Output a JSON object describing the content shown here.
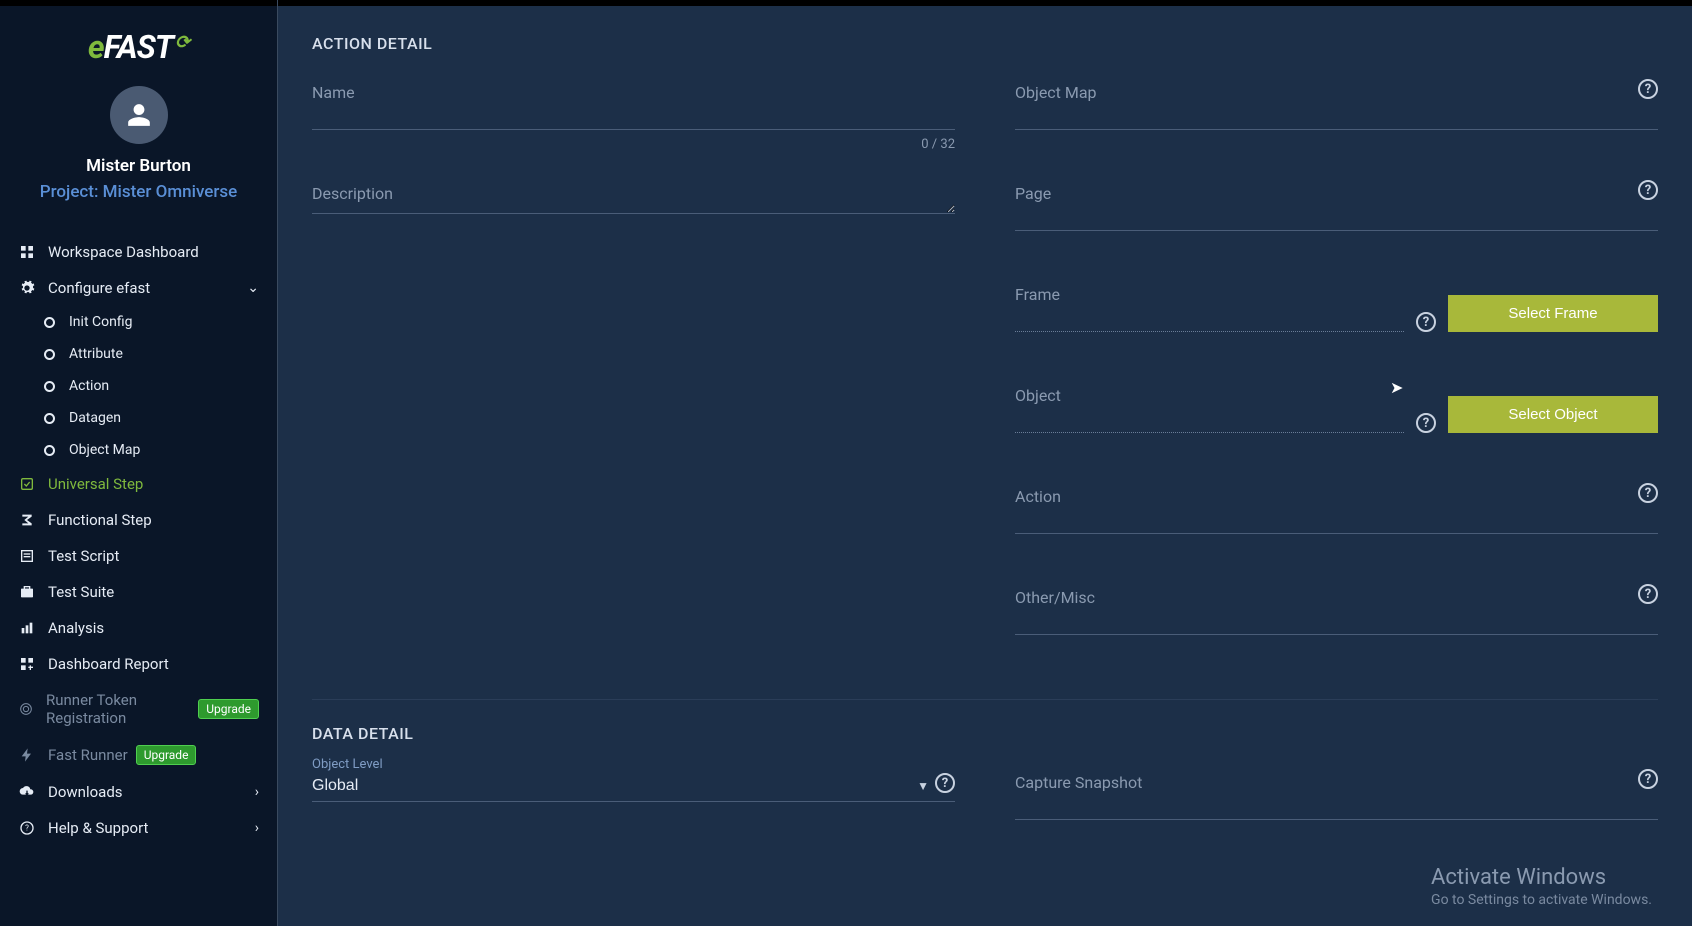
{
  "brand": {
    "name_e": "e",
    "name_fast": "FAST"
  },
  "user": {
    "name": "Mister Burton",
    "project": "Project: Mister Omniverse"
  },
  "nav": {
    "workspace": "Workspace Dashboard",
    "configure": "Configure efast",
    "init_config": "Init Config",
    "attribute": "Attribute",
    "action": "Action",
    "datagen": "Datagen",
    "object_map": "Object Map",
    "universal_step": "Universal Step",
    "functional_step": "Functional Step",
    "test_script": "Test Script",
    "test_suite": "Test Suite",
    "analysis": "Analysis",
    "dashboard_report": "Dashboard Report",
    "runner_token": "Runner Token Registration",
    "fast_runner": "Fast Runner",
    "downloads": "Downloads",
    "help": "Help & Support",
    "upgrade": "Upgrade"
  },
  "section": {
    "action_detail": "ACTION DETAIL",
    "data_detail": "DATA DETAIL"
  },
  "fields": {
    "name": "Name",
    "name_counter": "0 / 32",
    "description": "Description",
    "object_map": "Object Map",
    "page": "Page",
    "frame": "Frame",
    "object": "Object",
    "action": "Action",
    "other_misc": "Other/Misc",
    "object_level_label": "Object Level",
    "object_level_value": "Global",
    "capture_snapshot": "Capture Snapshot"
  },
  "buttons": {
    "select_frame": "Select Frame",
    "select_object": "Select Object"
  },
  "watermark": {
    "line1": "Activate Windows",
    "line2": "Go to Settings to activate Windows."
  }
}
